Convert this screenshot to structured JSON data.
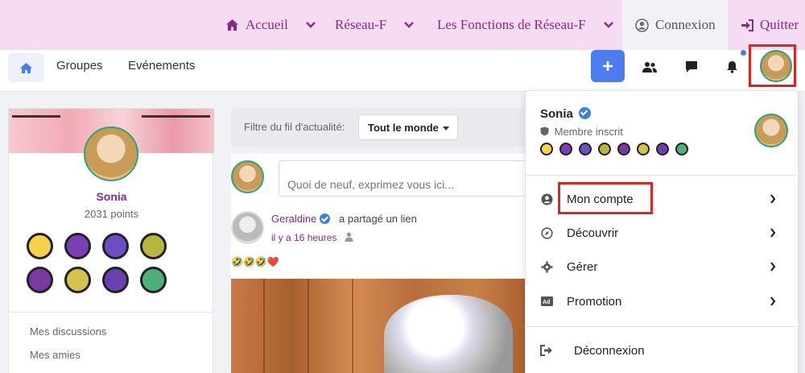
{
  "colors": {
    "brand_purple": "#8a2a84",
    "top_bar": "#f6dcf3",
    "accent_blue": "#4c7cf0",
    "highlight_red": "#e02323",
    "avatar_ring": "#2aa577"
  },
  "topnav": {
    "items": [
      {
        "label": "Accueil",
        "icon": "home-icon",
        "has_chevron": true
      },
      {
        "label": "Réseau-F",
        "has_chevron": true
      },
      {
        "label": "Les Fonctions de Réseau-F",
        "has_chevron": true
      },
      {
        "label": "Connexion",
        "icon": "user-circle-icon"
      },
      {
        "label": "Quitter",
        "icon": "sign-in-icon"
      }
    ]
  },
  "subnav": {
    "home_icon": "home-icon",
    "items": [
      {
        "label": "Groupes"
      },
      {
        "label": "Evénements"
      }
    ],
    "actions": [
      "plus-icon",
      "friends-icon",
      "message-icon",
      "bell-icon",
      "avatar"
    ]
  },
  "profile": {
    "name": "Sonia",
    "points": "2031 points",
    "badges": [
      {
        "color": "#f6d24a",
        "icon": "smiley-badge"
      },
      {
        "color": "#7c3fb6",
        "icon": "trophy-badge"
      },
      {
        "color": "#6c4ec4",
        "icon": "globe-badge"
      },
      {
        "color": "#b6b641",
        "icon": "tv-badge"
      },
      {
        "color": "#7a3aa2",
        "icon": "person-badge"
      },
      {
        "color": "#d4c24a",
        "icon": "flower-badge"
      },
      {
        "color": "#6a3fb0",
        "icon": "book-badge"
      },
      {
        "color": "#4fae7a",
        "icon": "phone-badge"
      }
    ],
    "links": [
      "Mes discussions",
      "Mes amies"
    ]
  },
  "feed": {
    "filter_label": "Filtre du fil d'actualité:",
    "filter_value": "Tout le monde",
    "composer_placeholder": "Quoi de neuf, exprimez vous ici...",
    "post": {
      "author": "Geraldine",
      "action": "a partagé un lien",
      "time": "il y a 16 heures",
      "content": "🤣🤣🤣❤️"
    }
  },
  "dropdown": {
    "name": "Sonia",
    "role": "Membre inscrit",
    "badge_colors": [
      "#f6d24a",
      "#7c3fb6",
      "#6c4ec4",
      "#b6b641",
      "#7a3aa2",
      "#d4c24a",
      "#6a3fb0",
      "#4fae7a"
    ],
    "items": [
      {
        "label": "Mon compte",
        "icon": "user-circle-icon",
        "has_chevron": true
      },
      {
        "label": "Découvrir",
        "icon": "compass-icon",
        "has_chevron": true
      },
      {
        "label": "Gérer",
        "icon": "gear-icon",
        "has_chevron": true
      },
      {
        "label": "Promotion",
        "icon": "ad-icon",
        "has_chevron": true
      }
    ],
    "logout": {
      "label": "Déconnexion",
      "icon": "logout-icon"
    }
  }
}
